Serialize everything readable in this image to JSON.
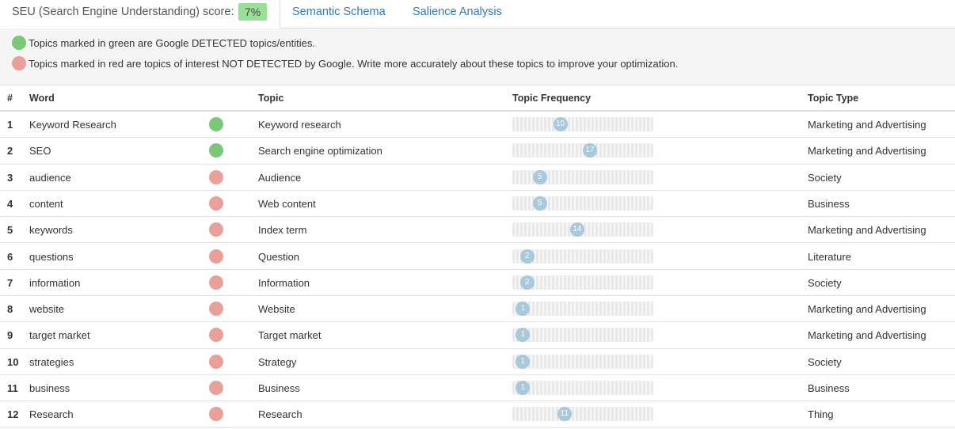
{
  "tabs": {
    "seu_label": "SEU (Search Engine Understanding) score:",
    "seu_score": "7%",
    "semantic_schema": "Semantic Schema",
    "salience_analysis": "Salience Analysis"
  },
  "legend": {
    "green_text": "Topics marked in green are Google DETECTED topics/entities.",
    "red_text": "Topics marked in red are topics of interest NOT DETECTED by Google. Write more accurately about these topics to improve your optimization."
  },
  "colors": {
    "detected": "#78c878",
    "not_detected": "#eaa09a",
    "score_badge": "#98e098",
    "link": "#337ab7"
  },
  "table": {
    "headers": {
      "num": "#",
      "word": "Word",
      "topic": "Topic",
      "frequency": "Topic Frequency",
      "type": "Topic Type"
    },
    "rows": [
      {
        "num": "1",
        "word": "Keyword Research",
        "detected": true,
        "topic": "Keyword research",
        "frequency": 10,
        "frequency_fraction": 0.34,
        "type": "Marketing and Advertising"
      },
      {
        "num": "2",
        "word": "SEO",
        "detected": true,
        "topic": "Search engine optimization",
        "frequency": 17,
        "frequency_fraction": 0.55,
        "type": "Marketing and Advertising"
      },
      {
        "num": "3",
        "word": "audience",
        "detected": false,
        "topic": "Audience",
        "frequency": 5,
        "frequency_fraction": 0.195,
        "type": "Society"
      },
      {
        "num": "4",
        "word": "content",
        "detected": false,
        "topic": "Web content",
        "frequency": 5,
        "frequency_fraction": 0.195,
        "type": "Business"
      },
      {
        "num": "5",
        "word": "keywords",
        "detected": false,
        "topic": "Index term",
        "frequency": 14,
        "frequency_fraction": 0.46,
        "type": "Marketing and Advertising"
      },
      {
        "num": "6",
        "word": "questions",
        "detected": false,
        "topic": "Question",
        "frequency": 2,
        "frequency_fraction": 0.105,
        "type": "Literature"
      },
      {
        "num": "7",
        "word": "information",
        "detected": false,
        "topic": "Information",
        "frequency": 2,
        "frequency_fraction": 0.105,
        "type": "Society"
      },
      {
        "num": "8",
        "word": "website",
        "detected": false,
        "topic": "Website",
        "frequency": 1,
        "frequency_fraction": 0.075,
        "type": "Marketing and Advertising"
      },
      {
        "num": "9",
        "word": "target market",
        "detected": false,
        "topic": "Target market",
        "frequency": 1,
        "frequency_fraction": 0.075,
        "type": "Marketing and Advertising"
      },
      {
        "num": "10",
        "word": "strategies",
        "detected": false,
        "topic": "Strategy",
        "frequency": 1,
        "frequency_fraction": 0.075,
        "type": "Society"
      },
      {
        "num": "11",
        "word": "business",
        "detected": false,
        "topic": "Business",
        "frequency": 1,
        "frequency_fraction": 0.075,
        "type": "Business"
      },
      {
        "num": "12",
        "word": "Research",
        "detected": false,
        "topic": "Research",
        "frequency": 11,
        "frequency_fraction": 0.37,
        "type": "Thing"
      }
    ]
  }
}
